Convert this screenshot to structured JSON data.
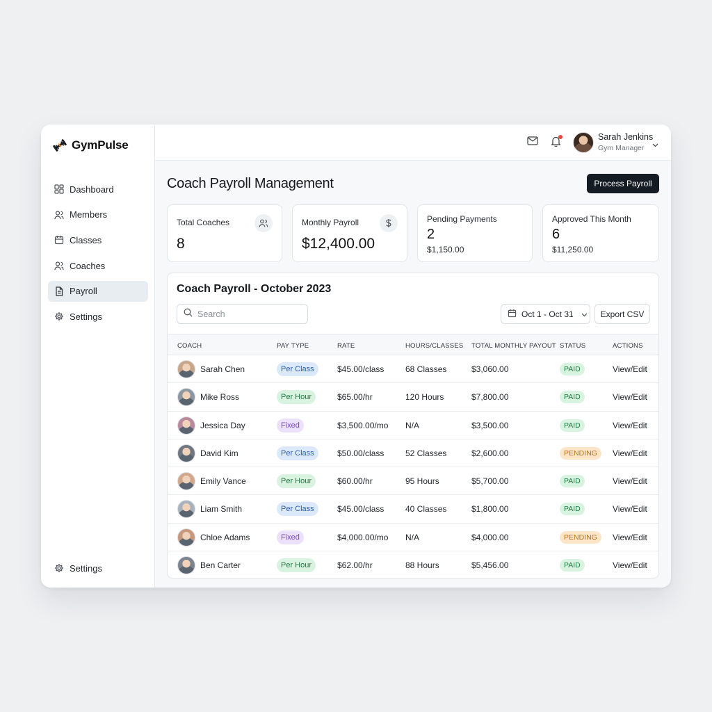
{
  "app": {
    "name": "GymPulse"
  },
  "sidebar": {
    "items": [
      {
        "label": "Dashboard",
        "icon": "dashboard-icon",
        "active": false
      },
      {
        "label": "Members",
        "icon": "members-icon",
        "active": false
      },
      {
        "label": "Classes",
        "icon": "calendar-icon",
        "active": false
      },
      {
        "label": "Coaches",
        "icon": "coaches-icon",
        "active": false
      },
      {
        "label": "Payroll",
        "icon": "document-icon",
        "active": true
      },
      {
        "label": "Settings",
        "icon": "gear-icon",
        "active": false
      }
    ],
    "bottom_item": {
      "label": "Settings",
      "icon": "gear-icon"
    }
  },
  "header": {
    "user_name": "Sarah Jenkins",
    "user_role": "Gym Manager",
    "notification_dot": true
  },
  "page": {
    "title": "Coach Payroll Management",
    "primary_action": "Process Payroll"
  },
  "stats": [
    {
      "label": "Total Coaches",
      "value": "8",
      "icon": "users-icon"
    },
    {
      "label": "Monthly Payroll",
      "value": "$12,400.00",
      "icon": "dollar-icon"
    },
    {
      "label": "Pending Payments",
      "value": "2",
      "sub": "$1,150.00"
    },
    {
      "label": "Approved This Month",
      "value": "6",
      "sub": "$11,250.00"
    }
  ],
  "table": {
    "title": "Coach Payroll - October 2023",
    "search_placeholder": "Search",
    "date_range": "Oct 1 - Oct 31",
    "export_label": "Export CSV",
    "columns": [
      "COACH",
      "PAY TYPE",
      "RATE",
      "HOURS/CLASSES",
      "TOTAL MONTHLY PAYOUT",
      "STATUS",
      "ACTIONS"
    ],
    "rows": [
      {
        "coach": "Sarah Chen",
        "pay_type": "Per Class",
        "rate": "$45.00/class",
        "hours": "68 Classes",
        "total": "$3,060.00",
        "status": "PAID",
        "action": "View/Edit"
      },
      {
        "coach": "Mike Ross",
        "pay_type": "Per Hour",
        "rate": "$65.00/hr",
        "hours": "120 Hours",
        "total": "$7,800.00",
        "status": "PAID",
        "action": "View/Edit"
      },
      {
        "coach": "Jessica Day",
        "pay_type": "Fixed",
        "rate": "$3,500.00/mo",
        "hours": "N/A",
        "total": "$3,500.00",
        "status": "PAID",
        "action": "View/Edit"
      },
      {
        "coach": "David Kim",
        "pay_type": "Per Class",
        "rate": "$50.00/class",
        "hours": "52 Classes",
        "total": "$2,600.00",
        "status": "PENDING",
        "action": "View/Edit"
      },
      {
        "coach": "Emily Vance",
        "pay_type": "Per Hour",
        "rate": "$60.00/hr",
        "hours": "95 Hours",
        "total": "$5,700.00",
        "status": "PAID",
        "action": "View/Edit"
      },
      {
        "coach": "Liam Smith",
        "pay_type": "Per Class",
        "rate": "$45.00/class",
        "hours": "40 Classes",
        "total": "$1,800.00",
        "status": "PAID",
        "action": "View/Edit"
      },
      {
        "coach": "Chloe Adams",
        "pay_type": "Fixed",
        "rate": "$4,000.00/mo",
        "hours": "N/A",
        "total": "$4,000.00",
        "status": "PENDING",
        "action": "View/Edit"
      },
      {
        "coach": "Ben Carter",
        "pay_type": "Per Hour",
        "rate": "$62.00/hr",
        "hours": "88 Hours",
        "total": "$5,456.00",
        "status": "PAID",
        "action": "View/Edit"
      }
    ]
  },
  "colors": {
    "primary_button": "#151b22",
    "per_class_bg": "#dbe9fb",
    "per_class_fg": "#2a5ea8",
    "per_hour_bg": "#d9f3e1",
    "per_hour_fg": "#217a43",
    "fixed_bg": "#ece1fb",
    "fixed_fg": "#7a48b8",
    "paid_bg": "#d9f3e1",
    "paid_fg": "#217a43",
    "pending_bg": "#fde6c8",
    "pending_fg": "#b3731b",
    "notification": "#e5483e"
  }
}
